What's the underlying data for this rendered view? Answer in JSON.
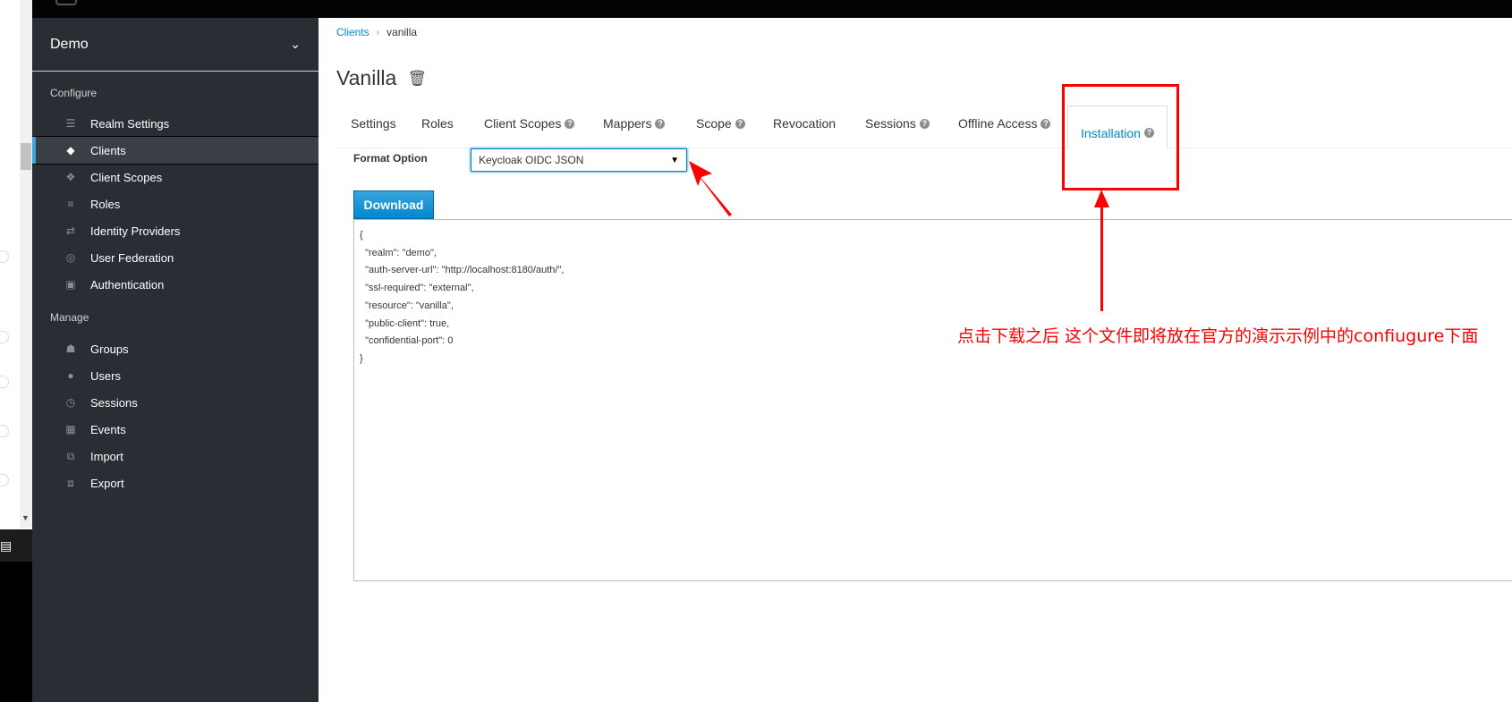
{
  "realm": {
    "name": "Demo"
  },
  "sidebar": {
    "configure_title": "Configure",
    "configure_items": [
      {
        "label": "Realm Settings",
        "icon": "sliders-icon"
      },
      {
        "label": "Clients",
        "icon": "cube-icon",
        "active": true
      },
      {
        "label": "Client Scopes",
        "icon": "cubes-icon"
      },
      {
        "label": "Roles",
        "icon": "list-icon"
      },
      {
        "label": "Identity Providers",
        "icon": "exchange-icon"
      },
      {
        "label": "User Federation",
        "icon": "database-icon"
      },
      {
        "label": "Authentication",
        "icon": "lock-icon"
      }
    ],
    "manage_title": "Manage",
    "manage_items": [
      {
        "label": "Groups",
        "icon": "users-icon"
      },
      {
        "label": "Users",
        "icon": "user-icon"
      },
      {
        "label": "Sessions",
        "icon": "clock-icon"
      },
      {
        "label": "Events",
        "icon": "calendar-icon"
      },
      {
        "label": "Import",
        "icon": "import-icon"
      },
      {
        "label": "Export",
        "icon": "export-icon"
      }
    ]
  },
  "breadcrumb": {
    "parent": "Clients",
    "current": "vanilla"
  },
  "page": {
    "title": "Vanilla"
  },
  "tabs": [
    {
      "label": "Settings",
      "help": false
    },
    {
      "label": "Roles",
      "help": false
    },
    {
      "label": "Client Scopes",
      "help": true
    },
    {
      "label": "Mappers",
      "help": true
    },
    {
      "label": "Scope",
      "help": true
    },
    {
      "label": "Revocation",
      "help": false
    },
    {
      "label": "Sessions",
      "help": true
    },
    {
      "label": "Offline Access",
      "help": true
    },
    {
      "label": "Installation",
      "help": true,
      "active": true
    }
  ],
  "installation": {
    "format_label": "Format Option",
    "format_value": "Keycloak OIDC JSON",
    "download_label": "Download",
    "config_text": "{\n  \"realm\": \"demo\",\n  \"auth-server-url\": \"http://localhost:8180/auth/\",\n  \"ssl-required\": \"external\",\n  \"resource\": \"vanilla\",\n  \"public-client\": true,\n  \"confidential-port\": 0\n}"
  },
  "annotation": {
    "text": "点击下载之后 这个文件即将放在官方的演示示例中的confiugure下面",
    "color": "#ff0000"
  },
  "colors": {
    "accent": "#0088ce",
    "sidebar_bg": "#292e34"
  }
}
